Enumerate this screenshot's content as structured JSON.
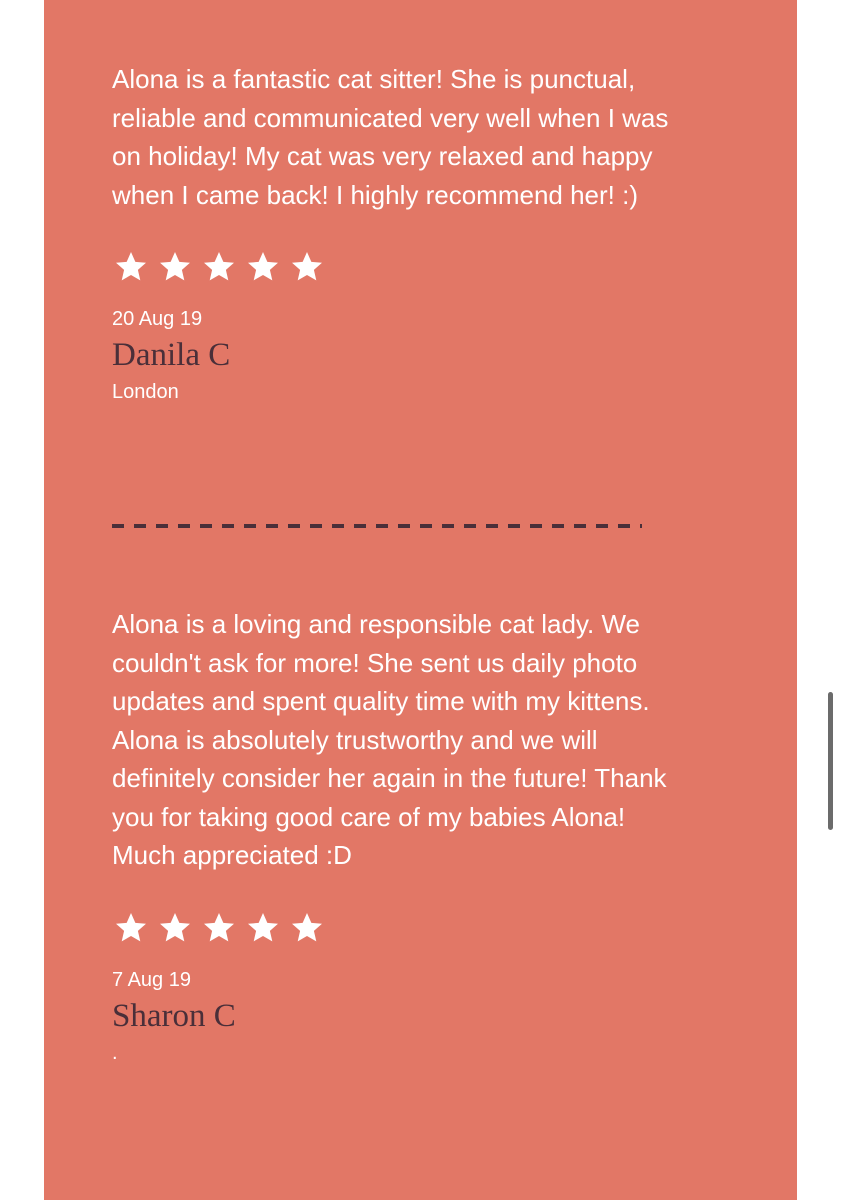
{
  "reviews": [
    {
      "text": "Alona is a fantastic cat sitter! She is punctual, reliable and communicated very well when I was on holiday! My cat was very relaxed and happy when I came back! I highly recommend her! :)",
      "rating": 5,
      "date": "20 Aug 19",
      "name": "Danila C",
      "location": "London"
    },
    {
      "text": "Alona is a loving and responsible cat lady. We couldn't ask for more! She sent us daily photo updates and spent quality time with my kittens. Alona is absolutely trustworthy and we will definitely consider her again in the future! Thank you for taking good care of my babies Alona! Much appreciated :D",
      "rating": 5,
      "date": "7 Aug 19",
      "name": "Sharon C",
      "location": "."
    }
  ],
  "colors": {
    "panel": "#e27766",
    "name": "#4a2f39",
    "divider": "#4a2f39",
    "text": "#ffffff"
  },
  "icons": {
    "star": "star-icon"
  }
}
